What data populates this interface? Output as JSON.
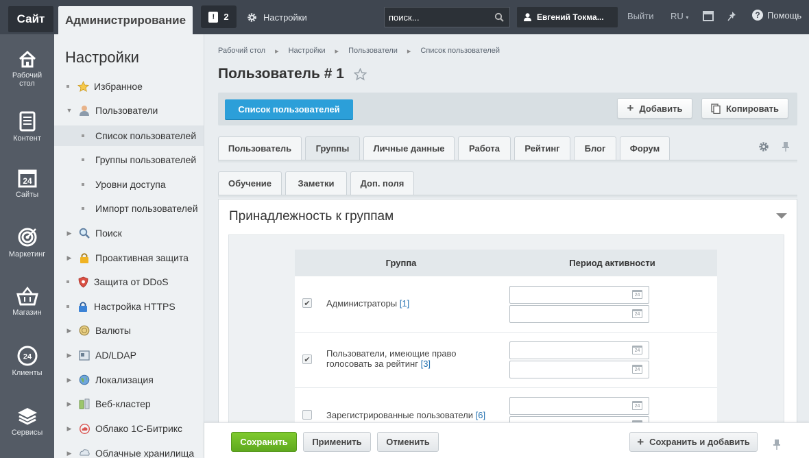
{
  "topbar": {
    "site": "Сайт",
    "admin": "Администрирование",
    "notifications_count": "2",
    "settings": "Настройки",
    "search_placeholder": "поиск...",
    "user": "Евгений Токма...",
    "logout": "Выйти",
    "lang": "RU",
    "help": "Помощь"
  },
  "iconbar": [
    {
      "label": "Рабочий стол",
      "icon": "home-icon"
    },
    {
      "label": "Контент",
      "icon": "document-icon"
    },
    {
      "label": "Сайты",
      "icon": "calendar-24-icon"
    },
    {
      "label": "Маркетинг",
      "icon": "target-icon"
    },
    {
      "label": "Магазин",
      "icon": "basket-icon"
    },
    {
      "label": "Клиенты",
      "icon": "clients-24-icon"
    },
    {
      "label": "Сервисы",
      "icon": "layers-icon"
    }
  ],
  "sidebar": {
    "title": "Настройки",
    "items": [
      {
        "label": "Избранное",
        "icon": "star-icon"
      },
      {
        "label": "Пользователи",
        "icon": "user-icon"
      },
      {
        "label": "Список пользователей"
      },
      {
        "label": "Группы пользователей"
      },
      {
        "label": "Уровни доступа"
      },
      {
        "label": "Импорт пользователей"
      },
      {
        "label": "Поиск",
        "icon": "search-icon"
      },
      {
        "label": "Проактивная защита",
        "icon": "lock-icon"
      },
      {
        "label": "Защита от DDoS",
        "icon": "shield-icon"
      },
      {
        "label": "Настройка HTTPS",
        "icon": "lock-icon"
      },
      {
        "label": "Валюты",
        "icon": "coin-icon"
      },
      {
        "label": "AD/LDAP",
        "icon": "ldap-icon"
      },
      {
        "label": "Локализация",
        "icon": "globe-icon"
      },
      {
        "label": "Веб-кластер",
        "icon": "cluster-icon"
      },
      {
        "label": "Облако 1С-Битрикс",
        "icon": "cloud-icon"
      },
      {
        "label": "Облачные хранилища",
        "icon": "storage-icon"
      }
    ]
  },
  "breadcrumbs": [
    "Рабочий стол",
    "Настройки",
    "Пользователи",
    "Список пользователей"
  ],
  "page_title": "Пользователь # 1",
  "toolbar": {
    "list_button": "Список пользователей",
    "add_button": "Добавить",
    "copy_button": "Копировать"
  },
  "tabs_row1": [
    "Пользователь",
    "Группы",
    "Личные данные",
    "Работа",
    "Рейтинг",
    "Блог",
    "Форум"
  ],
  "tabs_row2": [
    "Обучение",
    "Заметки",
    "Доп. поля"
  ],
  "panel": {
    "title": "Принадлежность к группам",
    "col_group": "Группа",
    "col_period": "Период активности",
    "rows": [
      {
        "label": "Администраторы",
        "count": "[1]",
        "checked": true
      },
      {
        "label": "Пользователи, имеющие право голосовать за рейтинг",
        "label_line1": "Пользователи, имеющие право",
        "label_line2": "голосовать за рейтинг",
        "count": "[3]",
        "checked": true
      },
      {
        "label": "Зарегистрированные пользователи",
        "count": "[6]",
        "checked": false
      }
    ],
    "calendar_day": "24"
  },
  "bottom": {
    "save": "Сохранить",
    "apply": "Применить",
    "cancel": "Отменить",
    "save_add": "Сохранить и добавить"
  },
  "colors": {
    "accent_blue": "#2c9fd9",
    "save_green": "#6cb825",
    "topbar": "#3f4650",
    "iconbar": "#545b65"
  }
}
